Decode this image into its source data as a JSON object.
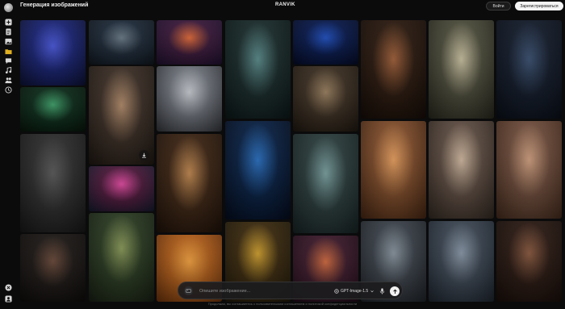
{
  "header": {
    "app_title": "Генерация изображений",
    "brand": "RANVIK",
    "login_label": "Войти",
    "signup_label": "Зарегистрироваться"
  },
  "sidebar": {
    "items": [
      {
        "icon": "plus-icon"
      },
      {
        "icon": "document-icon"
      },
      {
        "icon": "image-icon"
      },
      {
        "icon": "folder-icon"
      },
      {
        "icon": "chat-icon"
      },
      {
        "icon": "music-icon"
      },
      {
        "icon": "users-icon"
      },
      {
        "icon": "history-icon"
      }
    ],
    "bottom_items": [
      {
        "icon": "close-circle-icon"
      },
      {
        "icon": "account-icon"
      }
    ]
  },
  "prompt": {
    "placeholder": "Опишите изображение...",
    "model": "GPT-Image-1.5"
  },
  "footer": {
    "text": "Продолжая, вы соглашаетесь с пользовательским соглашением и политикой конфиденциальности"
  },
  "gallery": [
    {
      "name": "blue-cyborg-knight-image",
      "c1": "#1a2470",
      "c2": "#4a58d8",
      "c3": "#0c0f2a"
    },
    {
      "name": "glowing-forest-image",
      "c1": "#0d2a1a",
      "c2": "#3fa06a",
      "c3": "#071209"
    },
    {
      "name": "peaky-blinders-image",
      "c1": "#2c2c2c",
      "c2": "#5a5a5a",
      "c3": "#141414"
    },
    {
      "name": "fashion-women-image",
      "c1": "#1c1816",
      "c2": "#6a4a3a",
      "c3": "#0c0a09"
    },
    {
      "name": "dragon-storm-image",
      "c1": "#1e2a38",
      "c2": "#6a7b88",
      "c3": "#0e141a"
    },
    {
      "name": "woman-portrait-image",
      "c1": "#3a2e26",
      "c2": "#b08a6a",
      "c3": "#1a140f"
    },
    {
      "name": "neon-street-crowd-image",
      "c1": "#4a1a3a",
      "c2": "#e04aa0",
      "c3": "#101828"
    },
    {
      "name": "stone-warrior-statue-image",
      "c1": "#2a3a22",
      "c2": "#8a9a5a",
      "c3": "#141a10"
    },
    {
      "name": "anime-warrior-girl-image",
      "c1": "#3a1a3a",
      "c2": "#e06a3a",
      "c3": "#1a0f2a"
    },
    {
      "name": "cute-robot-image",
      "c1": "#6a6e76",
      "c2": "#c8ccd2",
      "c3": "#2a2c30"
    },
    {
      "name": "woman-window-light-image",
      "c1": "#3a2414",
      "c2": "#c08850",
      "c3": "#1a0f08"
    },
    {
      "name": "desert-dunes-image",
      "c1": "#a85a1a",
      "c2": "#f0a040",
      "c3": "#5a2a0a"
    },
    {
      "name": "cheburashka-image",
      "c1": "#1a2a2a",
      "c2": "#5a8a8a",
      "c3": "#0a1414"
    },
    {
      "name": "flying-cow-space-image",
      "c1": "#0a2040",
      "c2": "#2a70c0",
      "c3": "#040a18"
    },
    {
      "name": "fruit-characters-image",
      "c1": "#3a2a10",
      "c2": "#d0a030",
      "c3": "#1a1408"
    },
    {
      "name": "energy-drink-can-image",
      "c1": "#0a1a4a",
      "c2": "#2050c0",
      "c3": "#050a20"
    },
    {
      "name": "medieval-crowd-image",
      "c1": "#3a2e22",
      "c2": "#9a8060",
      "c3": "#1a140e"
    },
    {
      "name": "robots-classroom-image",
      "c1": "#2a3a3a",
      "c2": "#7aa0a0",
      "c3": "#141e1e"
    },
    {
      "name": "sunset-sports-car-image",
      "c1": "#3a1a2a",
      "c2": "#d06a40",
      "c3": "#1a0a14"
    },
    {
      "name": "astronaut-portrait-image",
      "c1": "#2a1a10",
      "c2": "#a0603a",
      "c3": "#120a06"
    },
    {
      "name": "puppy-red-square-image",
      "c1": "#7a4a2a",
      "c2": "#e8a060",
      "c3": "#3a2010"
    },
    {
      "name": "truck-tiny-house-image",
      "c1": "#3a4048",
      "c2": "#8a96a0",
      "c3": "#1a1e22"
    },
    {
      "name": "modern-house-image",
      "c1": "#4a4a3a",
      "c2": "#c8c0a0",
      "c3": "#22221a"
    },
    {
      "name": "two-women-studio-image",
      "c1": "#5a4a40",
      "c2": "#d0b8a0",
      "c3": "#2a221c"
    },
    {
      "name": "concrete-tower-image",
      "c1": "#3a4450",
      "c2": "#8a98a8",
      "c3": "#1a2028"
    },
    {
      "name": "city-rain-night-image",
      "c1": "#141c2a",
      "c2": "#3a5070",
      "c3": "#080c14"
    },
    {
      "name": "woman-beach-image",
      "c1": "#6a4a3a",
      "c2": "#d0a080",
      "c3": "#3a2418"
    },
    {
      "name": "bodybuilder-woman-image",
      "c1": "#2a1a14",
      "c2": "#8a5a40",
      "c3": "#140c08"
    }
  ]
}
